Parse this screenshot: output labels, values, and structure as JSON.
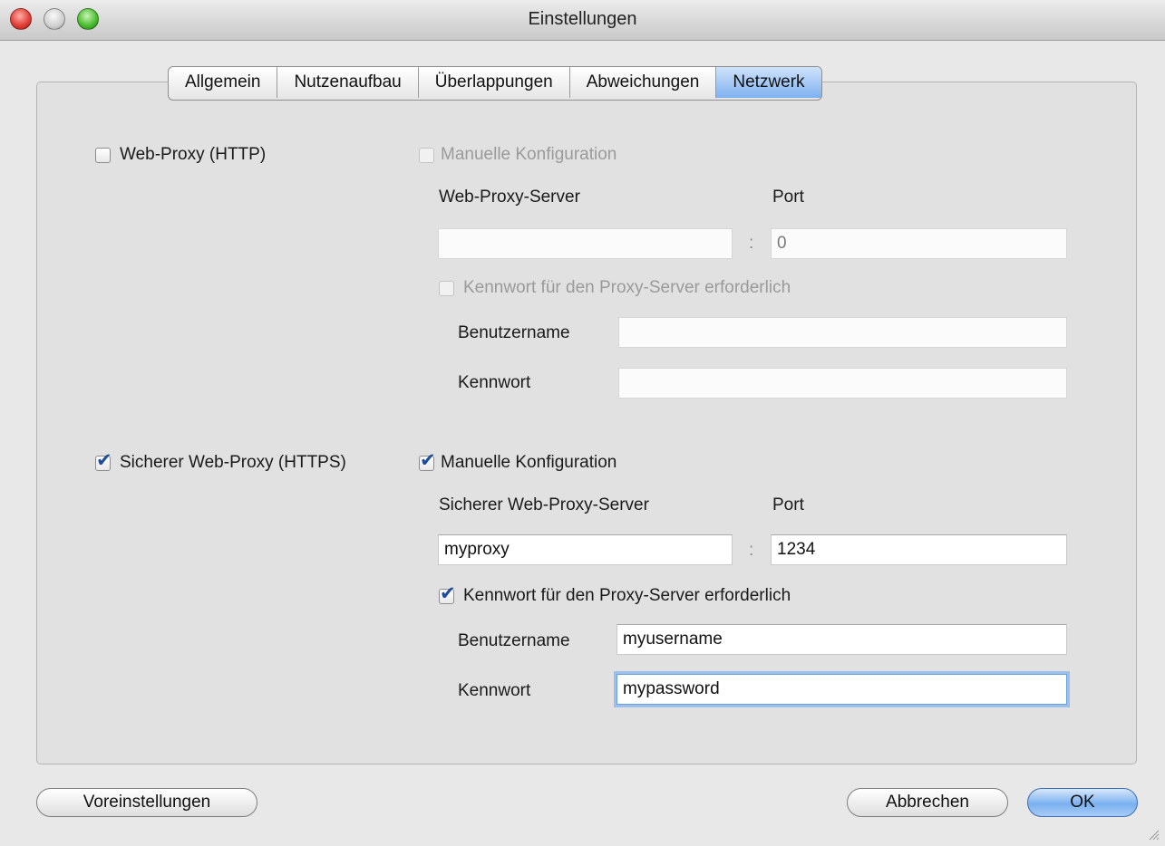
{
  "window": {
    "title": "Einstellungen"
  },
  "tabs": [
    "Allgemein",
    "Nutzenaufbau",
    "Überlappungen",
    "Abweichungen",
    "Netzwerk"
  ],
  "active_tab": "Netzwerk",
  "http": {
    "enable_label": "Web-Proxy (HTTP)",
    "enabled": false,
    "manual_label": "Manuelle Konfiguration",
    "manual": false,
    "server_label": "Web-Proxy-Server",
    "port_label": "Port",
    "server_value": "",
    "colon": ":",
    "port_value": "0",
    "auth_label": "Kennwort für den Proxy-Server erforderlich",
    "auth": false,
    "username_label": "Benutzername",
    "username_value": "",
    "password_label": "Kennwort",
    "password_value": ""
  },
  "https": {
    "enable_label": "Sicherer Web-Proxy (HTTPS)",
    "enabled": true,
    "manual_label": "Manuelle Konfiguration",
    "manual": true,
    "server_label": "Sicherer Web-Proxy-Server",
    "port_label": "Port",
    "server_value": "myproxy",
    "colon": ":",
    "port_value": "1234",
    "auth_label": "Kennwort für den Proxy-Server erforderlich",
    "auth": true,
    "username_label": "Benutzername",
    "username_value": "myusername",
    "password_label": "Kennwort",
    "password_value": "mypassword"
  },
  "buttons": {
    "defaults": "Voreinstellungen",
    "cancel": "Abbrechen",
    "ok": "OK"
  },
  "check_glyph": "✔"
}
